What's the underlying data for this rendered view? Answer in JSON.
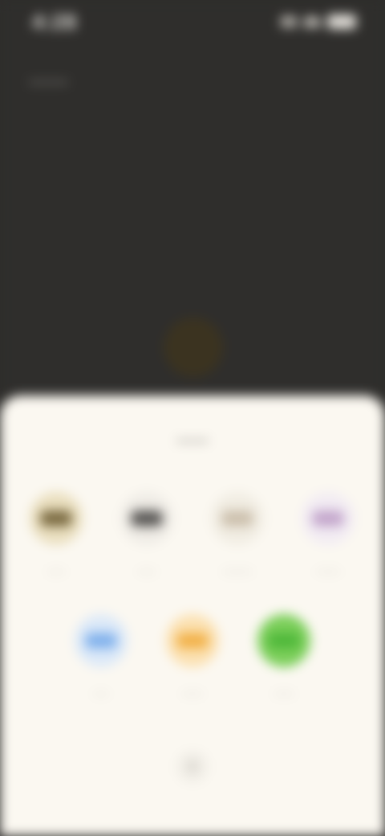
{
  "status_bar": {
    "time": "4:28",
    "icons": [
      "signal-icon",
      "wifi-icon",
      "battery-icon"
    ]
  },
  "header": {
    "title": "........"
  },
  "sheet": {
    "title": "........",
    "options_row1": [
      {
        "label": "......",
        "icon": "sticker-icon",
        "color": "#eadfbf",
        "glyph": "#7b6b42"
      },
      {
        "label": "......",
        "icon": "keyboard-icon",
        "color": "#efece6",
        "glyph": "#5a5856"
      },
      {
        "label": "..........",
        "icon": "document-icon",
        "color": "#f1ede3",
        "glyph": "#ccc0ad"
      },
      {
        "label": "........",
        "icon": "tag-icon",
        "color": "#f2ecf3",
        "glyph": "#c4a7cc"
      }
    ],
    "options_row2": [
      {
        "label": ".....",
        "icon": "cloud-icon",
        "color": "#dce9f8",
        "glyph": "#82b2ec"
      },
      {
        "label": ".......",
        "icon": "star-icon",
        "color": "#fbe1b2",
        "glyph": "#f2b24a"
      },
      {
        "label": ".......",
        "icon": "chat-icon",
        "color": "#7ccf5a",
        "glyph": "#4fb83a"
      }
    ],
    "close_label": "×"
  }
}
